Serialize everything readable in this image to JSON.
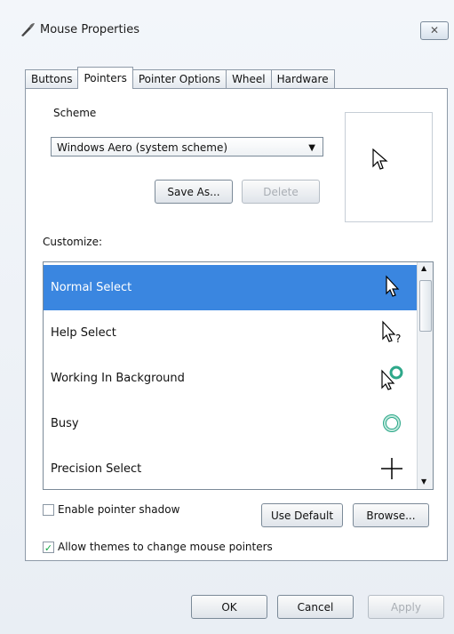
{
  "window": {
    "title": "Mouse Properties",
    "close_glyph": "✕"
  },
  "tabs": [
    {
      "label": "Buttons"
    },
    {
      "label": "Pointers",
      "active": true
    },
    {
      "label": "Pointer Options"
    },
    {
      "label": "Wheel"
    },
    {
      "label": "Hardware"
    }
  ],
  "scheme": {
    "label": "Scheme",
    "selected": "Windows Aero (system scheme)",
    "save_as": "Save As...",
    "delete": "Delete"
  },
  "customize": {
    "label": "Customize:",
    "rows": [
      {
        "label": "Normal Select",
        "icon": "arrow-pointer-icon",
        "selected": true
      },
      {
        "label": "Help Select",
        "icon": "help-pointer-icon"
      },
      {
        "label": "Working In Background",
        "icon": "working-pointer-icon"
      },
      {
        "label": "Busy",
        "icon": "busy-ring-icon"
      },
      {
        "label": "Precision Select",
        "icon": "crosshair-icon"
      }
    ]
  },
  "options": {
    "shadow": {
      "label": "Enable pointer shadow",
      "checked": false
    },
    "themes": {
      "label": "Allow themes to change mouse pointers",
      "checked": true
    },
    "use_default": "Use Default",
    "browse": "Browse..."
  },
  "footer": {
    "ok": "OK",
    "cancel": "Cancel",
    "apply": "Apply"
  }
}
